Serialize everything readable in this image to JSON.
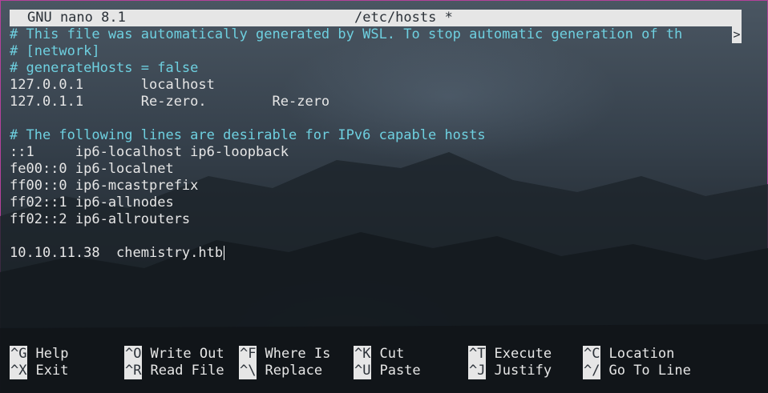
{
  "titlebar": {
    "app": "GNU nano 8.1",
    "filename": "/etc/hosts *"
  },
  "editor": {
    "lines": [
      {
        "text": "# This file was automatically generated by WSL. To stop automatic generation of th",
        "type": "comment"
      },
      {
        "text": "# [network]",
        "type": "comment"
      },
      {
        "text": "# generateHosts = false",
        "type": "comment"
      },
      {
        "text": "127.0.0.1       localhost",
        "type": "normal"
      },
      {
        "text": "127.0.1.1       Re-zero.        Re-zero",
        "type": "normal"
      },
      {
        "text": "",
        "type": "normal"
      },
      {
        "text": "# The following lines are desirable for IPv6 capable hosts",
        "type": "comment"
      },
      {
        "text": "::1     ip6-localhost ip6-loopback",
        "type": "normal"
      },
      {
        "text": "fe00::0 ip6-localnet",
        "type": "normal"
      },
      {
        "text": "ff00::0 ip6-mcastprefix",
        "type": "normal"
      },
      {
        "text": "ff02::1 ip6-allnodes",
        "type": "normal"
      },
      {
        "text": "ff02::2 ip6-allrouters",
        "type": "normal"
      },
      {
        "text": "",
        "type": "normal"
      },
      {
        "text": "10.10.11.38  chemistry.htb",
        "type": "normal"
      }
    ],
    "overflow_indicator": ">"
  },
  "shortcuts": [
    {
      "key": "^G",
      "label": "Help"
    },
    {
      "key": "^O",
      "label": "Write Out"
    },
    {
      "key": "^F",
      "label": "Where Is"
    },
    {
      "key": "^K",
      "label": "Cut"
    },
    {
      "key": "^T",
      "label": "Execute"
    },
    {
      "key": "^C",
      "label": "Location"
    },
    {
      "key": "^X",
      "label": "Exit"
    },
    {
      "key": "^R",
      "label": "Read File"
    },
    {
      "key": "^\\",
      "label": "Replace"
    },
    {
      "key": "^U",
      "label": "Paste"
    },
    {
      "key": "^J",
      "label": "Justify"
    },
    {
      "key": "^/",
      "label": "Go To Line"
    }
  ],
  "colors": {
    "comment": "#6ed0e0",
    "text": "#e6e6e6",
    "bar": "#e6e6e6",
    "frame": "#b4419b"
  }
}
